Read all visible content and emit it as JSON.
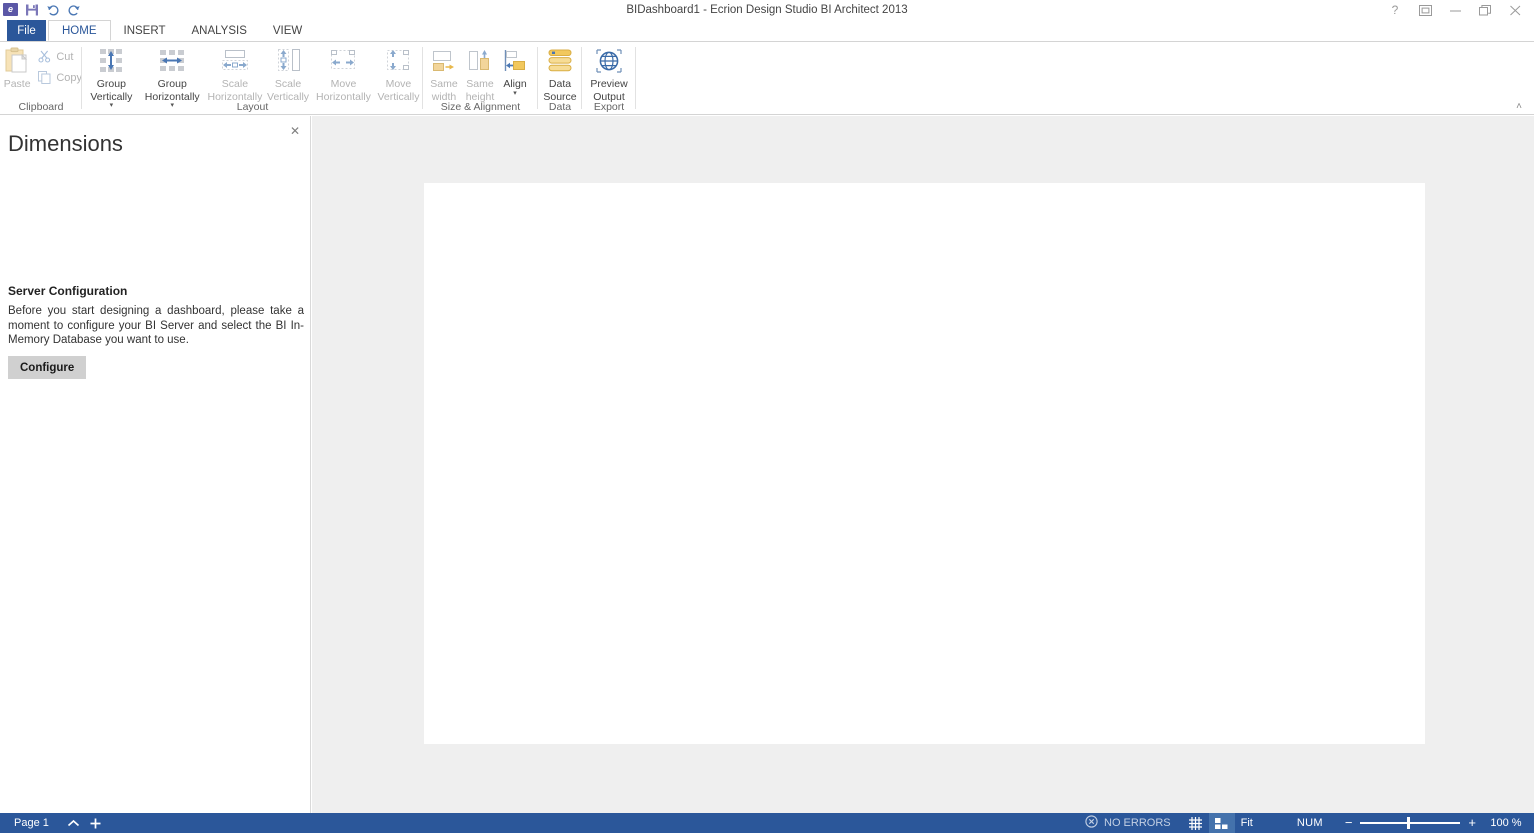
{
  "window": {
    "title": "BIDashboard1 - Ecrion Design Studio BI Architect 2013",
    "quick_access": [
      {
        "name": "app-logo-icon",
        "label": "e"
      },
      {
        "name": "save-icon",
        "label": "Save"
      },
      {
        "name": "undo-icon",
        "label": "Undo"
      },
      {
        "name": "redo-icon",
        "label": "Redo"
      }
    ],
    "controls": [
      {
        "name": "help-icon",
        "label": "?"
      },
      {
        "name": "ribbon-display-options-icon",
        "label": "Ribbon Display Options"
      },
      {
        "name": "minimize-icon",
        "label": "Minimize"
      },
      {
        "name": "restore-icon",
        "label": "Restore Down"
      },
      {
        "name": "close-icon",
        "label": "Close"
      }
    ]
  },
  "tabs": {
    "file_label": "File",
    "items": [
      {
        "label": "HOME",
        "active": true
      },
      {
        "label": "INSERT",
        "active": false
      },
      {
        "label": "ANALYSIS",
        "active": false
      },
      {
        "label": "VIEW",
        "active": false
      }
    ]
  },
  "ribbon": {
    "collapse_label": "˄",
    "groups": [
      {
        "name": "clipboard",
        "label": "Clipboard",
        "buttons": [
          {
            "name": "paste-button",
            "label": "Paste",
            "icon": "paste-icon",
            "disabled": true
          },
          {
            "name": "cut-button",
            "label": "Cut",
            "icon": "scissors-icon",
            "disabled": true
          },
          {
            "name": "copy-button",
            "label": "Copy",
            "icon": "copy-icon",
            "disabled": true
          }
        ]
      },
      {
        "name": "layout",
        "label": "Layout",
        "buttons": [
          {
            "name": "group-vertically-button",
            "label": "Group\nVertically",
            "icon": "group-vertical-icon",
            "disabled": false,
            "dropdown": true
          },
          {
            "name": "group-horizontally-button",
            "label": "Group\nHorizontally",
            "icon": "group-horizontal-icon",
            "disabled": false,
            "dropdown": true
          },
          {
            "name": "scale-horizontally-button",
            "label": "Scale\nHorizontally",
            "icon": "scale-horizontal-icon",
            "disabled": true
          },
          {
            "name": "scale-vertically-button",
            "label": "Scale\nVertically",
            "icon": "scale-vertical-icon",
            "disabled": true
          },
          {
            "name": "move-horizontally-button",
            "label": "Move\nHorizontally",
            "icon": "move-horizontal-icon",
            "disabled": true
          },
          {
            "name": "move-vertically-button",
            "label": "Move\nVertically",
            "icon": "move-vertical-icon",
            "disabled": true
          }
        ]
      },
      {
        "name": "size-and-alignment",
        "label": "Size & Alignment",
        "buttons": [
          {
            "name": "same-width-button",
            "label": "Same\nwidth",
            "icon": "same-width-icon",
            "disabled": true
          },
          {
            "name": "same-height-button",
            "label": "Same\nheight",
            "icon": "same-height-icon",
            "disabled": true
          },
          {
            "name": "align-button",
            "label": "Align",
            "icon": "align-icon",
            "disabled": false,
            "dropdown": true
          }
        ]
      },
      {
        "name": "data",
        "label": "Data",
        "buttons": [
          {
            "name": "data-source-button",
            "label": "Data\nSource",
            "icon": "database-icon",
            "disabled": false
          }
        ]
      },
      {
        "name": "export",
        "label": "Export",
        "buttons": [
          {
            "name": "preview-output-button",
            "label": "Preview\nOutput",
            "icon": "globe-icon",
            "disabled": false
          }
        ]
      }
    ]
  },
  "panel": {
    "title": "Dimensions",
    "close_label": "✕",
    "section_title": "Server Configuration",
    "body": "Before you start designing a dashboard, please take a moment to configure your BI Server and select the BI In-Memory Database you want to use.",
    "configure_label": "Configure"
  },
  "statusbar": {
    "page_label": "Page 1",
    "collapse_icon": "chevron-up-icon",
    "add_icon": "plus-icon",
    "errors_label": "NO ERRORS",
    "errors_icon": "error-circle-icon",
    "grid_icon": "grid-icon",
    "layout_icon": "layout-panes-icon",
    "fit_label": "Fit",
    "num_label": "NUM",
    "zoom_out_label": "−",
    "zoom_in_label": "+",
    "zoom_value": "100 %"
  },
  "colors": {
    "accent": "#2b579a",
    "ribbon_bg": "#ffffff",
    "canvas_bg": "#efefef",
    "page_bg": "#ffffff",
    "icon_blue": "#4a77b4",
    "icon_orange": "#f0c060"
  }
}
